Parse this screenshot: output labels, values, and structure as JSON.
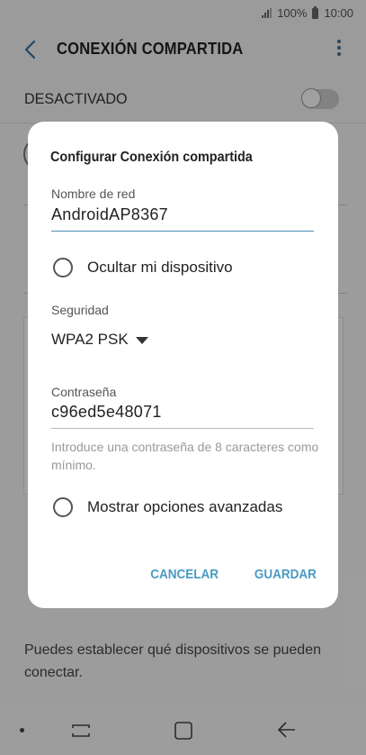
{
  "status_bar": {
    "battery": "100%",
    "time": "10:00"
  },
  "header": {
    "title": "CONEXIÓN COMPARTIDA"
  },
  "master_switch": {
    "label": "DESACTIVADO",
    "state": "off"
  },
  "description": "Puedes establecer qué dispositivos se pueden conectar.",
  "dialog": {
    "title": "Configurar Conexión compartida",
    "network_name": {
      "label": "Nombre de red",
      "value": "AndroidAP8367"
    },
    "hide_device": {
      "label": "Ocultar mi dispositivo",
      "checked": false
    },
    "security": {
      "label": "Seguridad",
      "value": "WPA2 PSK"
    },
    "password": {
      "label": "Contraseña",
      "value": "c96ed5e48071",
      "helper": "Introduce una contraseña de 8 caracteres como mínimo."
    },
    "advanced": {
      "label": "Mostrar opciones avanzadas",
      "checked": false
    },
    "cancel_label": "CANCELAR",
    "save_label": "GUARDAR"
  },
  "colors": {
    "accent": "#4a9ac3",
    "title_text": "#222222",
    "back_arrow": "#3a6f9a"
  }
}
